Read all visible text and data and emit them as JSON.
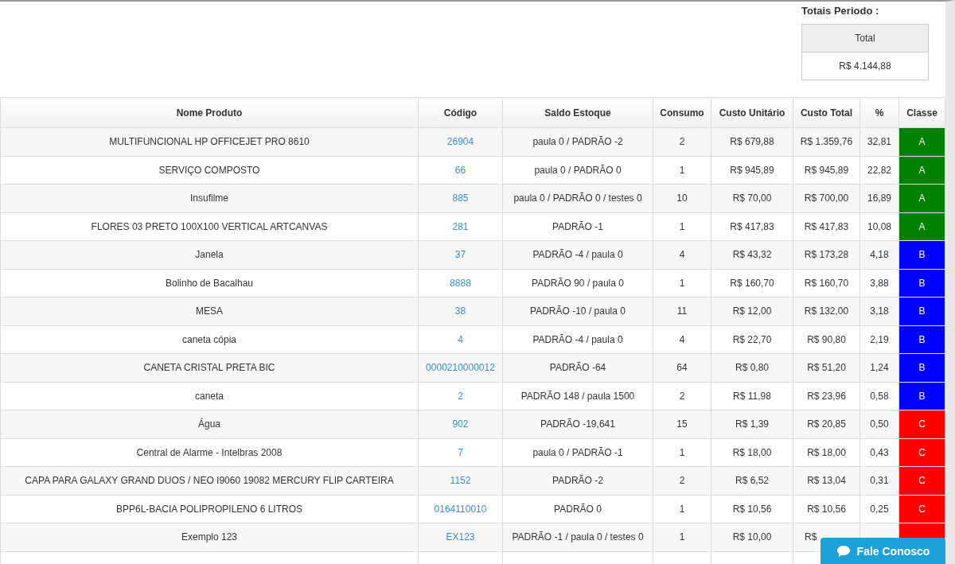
{
  "totals": {
    "heading": "Totais Periodo :",
    "column": "Total",
    "value": "R$ 4.144,88"
  },
  "table": {
    "columns": [
      "Nome Produto",
      "Código",
      "Saldo Estoque",
      "Consumo",
      "Custo Unitário",
      "Custo Total",
      "%",
      "Classe"
    ],
    "rows": [
      {
        "name": "MULTIFUNCIONAL HP OFFICEJET PRO 8610",
        "code": "26904",
        "stock": "paula 0 / PADRÃO -2",
        "consumption": "2",
        "unit_cost": "R$ 679,88",
        "total_cost": "R$ 1.359,76",
        "percent": "32,81",
        "class": "A",
        "color": "#008000"
      },
      {
        "name": "SERVIÇO COMPOSTO",
        "code": "66",
        "stock": "paula 0 / PADRÃO 0",
        "consumption": "1",
        "unit_cost": "R$ 945,89",
        "total_cost": "R$ 945,89",
        "percent": "22,82",
        "class": "A",
        "color": "#008000"
      },
      {
        "name": "Insufilme",
        "code": "885",
        "stock": "paula 0 / PADRÃO 0 / testes 0",
        "consumption": "10",
        "unit_cost": "R$ 70,00",
        "total_cost": "R$ 700,00",
        "percent": "16,89",
        "class": "A",
        "color": "#008000"
      },
      {
        "name": "FLORES 03 PRETO 100X100 VERTICAL ARTCANVAS",
        "code": "281",
        "stock": "PADRÃO -1",
        "consumption": "1",
        "unit_cost": "R$ 417,83",
        "total_cost": "R$ 417,83",
        "percent": "10,08",
        "class": "A",
        "color": "#008000"
      },
      {
        "name": "Janela",
        "code": "37",
        "stock": "PADRÃO -4 / paula 0",
        "consumption": "4",
        "unit_cost": "R$ 43,32",
        "total_cost": "R$ 173,28",
        "percent": "4,18",
        "class": "B",
        "color": "#0000ff"
      },
      {
        "name": "Bolinho de Bacalhau",
        "code": "8888",
        "stock": "PADRÃO 90 / paula 0",
        "consumption": "1",
        "unit_cost": "R$ 160,70",
        "total_cost": "R$ 160,70",
        "percent": "3,88",
        "class": "B",
        "color": "#0000ff"
      },
      {
        "name": "MESA",
        "code": "38",
        "stock": "PADRÃO -10 / paula 0",
        "consumption": "11",
        "unit_cost": "R$ 12,00",
        "total_cost": "R$ 132,00",
        "percent": "3,18",
        "class": "B",
        "color": "#0000ff"
      },
      {
        "name": "caneta cópia",
        "code": "4",
        "stock": "PADRÃO -4 / paula 0",
        "consumption": "4",
        "unit_cost": "R$ 22,70",
        "total_cost": "R$ 90,80",
        "percent": "2,19",
        "class": "B",
        "color": "#0000ff"
      },
      {
        "name": "CANETA CRISTAL PRETA BIC",
        "code": "0000210000012",
        "stock": "PADRÃO -64",
        "consumption": "64",
        "unit_cost": "R$ 0,80",
        "total_cost": "R$ 51,20",
        "percent": "1,24",
        "class": "B",
        "color": "#0000ff"
      },
      {
        "name": "caneta",
        "code": "2",
        "stock": "PADRÃO 148 / paula 1500",
        "consumption": "2",
        "unit_cost": "R$ 11,98",
        "total_cost": "R$ 23,96",
        "percent": "0,58",
        "class": "B",
        "color": "#0000ff"
      },
      {
        "name": "Água",
        "code": "902",
        "stock": "PADRÃO -19,641",
        "consumption": "15",
        "unit_cost": "R$ 1,39",
        "total_cost": "R$ 20,85",
        "percent": "0,50",
        "class": "C",
        "color": "#ff0000"
      },
      {
        "name": "Central de Alarme - Intelbras 2008",
        "code": "7",
        "stock": "paula 0 / PADRÃO -1",
        "consumption": "1",
        "unit_cost": "R$ 18,00",
        "total_cost": "R$ 18,00",
        "percent": "0,43",
        "class": "C",
        "color": "#ff0000"
      },
      {
        "name": "CAPA PARA GALAXY GRAND DUOS / NEO I9060 19082 MERCURY FLIP CARTEIRA",
        "code": "1152",
        "stock": "PADRÃO -2",
        "consumption": "2",
        "unit_cost": "R$ 6,52",
        "total_cost": "R$ 13,04",
        "percent": "0,31",
        "class": "C",
        "color": "#ff0000"
      },
      {
        "name": "BPP6L-BACIA POLIPROPILENO 6 LITROS",
        "code": "0164110010",
        "stock": "PADRÃO 0",
        "consumption": "1",
        "unit_cost": "R$ 10,56",
        "total_cost": "R$ 10,56",
        "percent": "0,25",
        "class": "C",
        "color": "#ff0000"
      },
      {
        "name": "Exemplo 123",
        "code": "EX123",
        "stock": "PADRÃO -1 / paula 0 / testes 0",
        "consumption": "1",
        "unit_cost": "R$ 10,00",
        "total_cost": "R$",
        "color": "#ff0000"
      }
    ]
  },
  "chat_button": {
    "label": "Fale Conosco"
  }
}
